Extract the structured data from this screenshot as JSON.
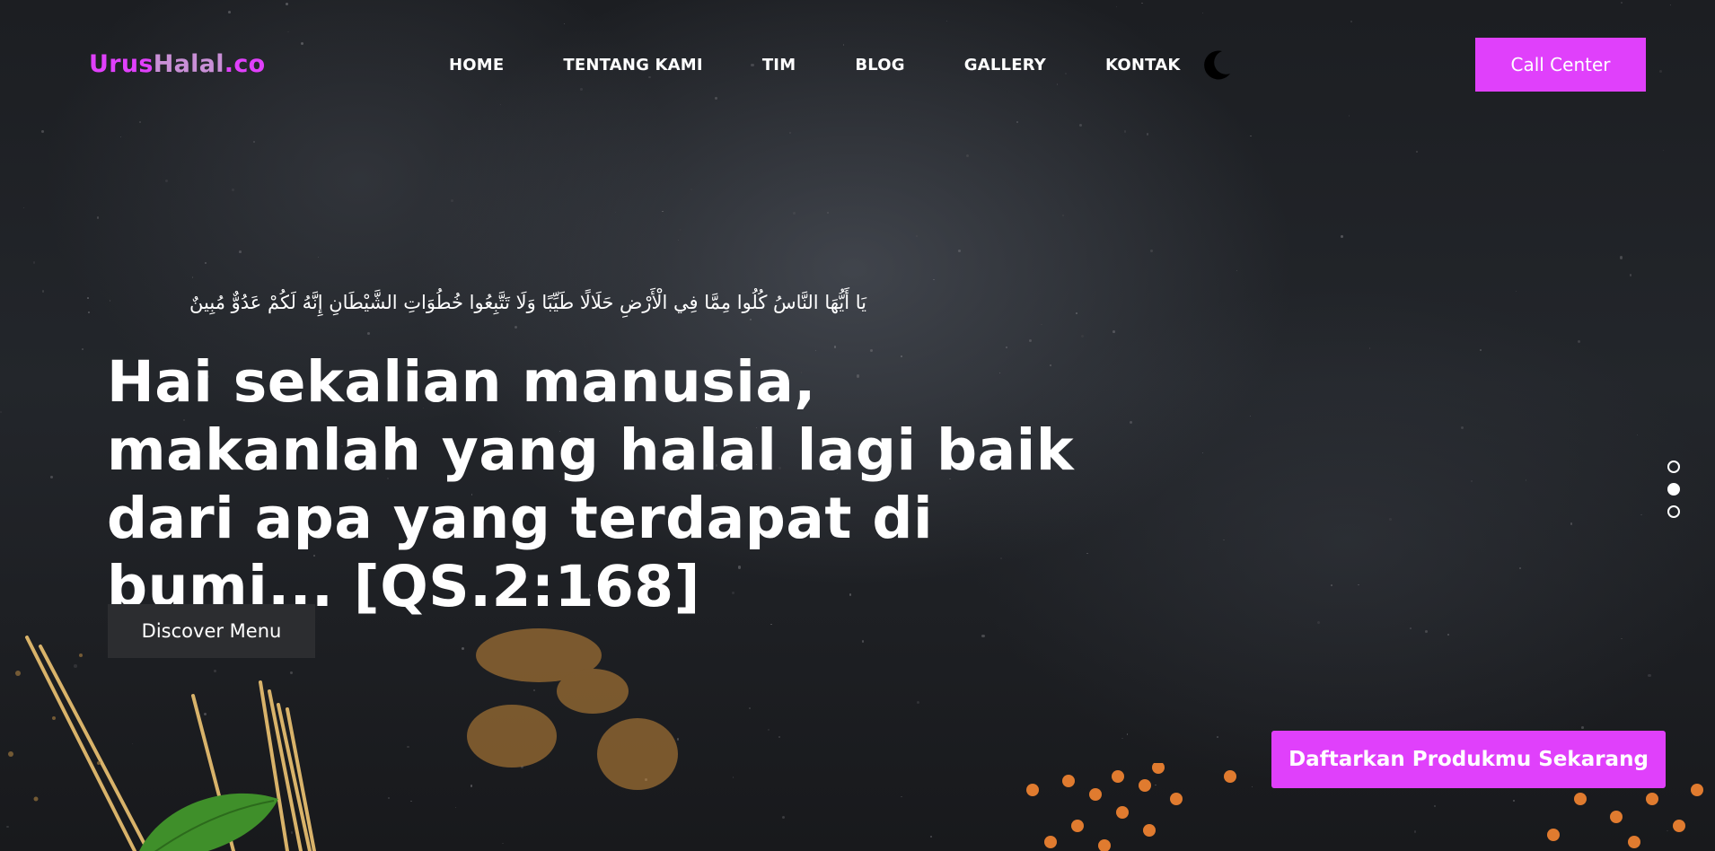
{
  "brand": {
    "part1": "Urus",
    "part2": "Halal",
    "part3": ".co"
  },
  "nav": {
    "items": [
      {
        "label": "HOME"
      },
      {
        "label": "TENTANG KAMI"
      },
      {
        "label": "TIM"
      },
      {
        "label": "BLOG"
      },
      {
        "label": "GALLERY"
      },
      {
        "label": "KONTAK"
      }
    ],
    "theme_toggle_icon": "moon-icon"
  },
  "header": {
    "call_center_label": "Call Center"
  },
  "hero": {
    "arabic_verse": "يَا أَيُّهَا النَّاسُ كُلُوا مِمَّا فِي الْأَرْضِ حَلَالًا طَيِّبًا وَلَا تَتَّبِعُوا خُطُوَاتِ الشَّيْطَانِ إِنَّهُ لَكُمْ عَدُوٌّ مُبِينٌ",
    "headline": "Hai sekalian manusia, makanlah yang halal lagi baik dari apa yang terdapat di bumi... [QS.2:168]",
    "discover_label": "Discover Menu",
    "register_label": "Daftarkan Produkmu Sekarang"
  },
  "slider": {
    "active_index": 1,
    "count": 3
  },
  "colors": {
    "accent": "#e040fb",
    "brand_mid": "#c98fd6",
    "dark_button": "#2c2d30"
  }
}
